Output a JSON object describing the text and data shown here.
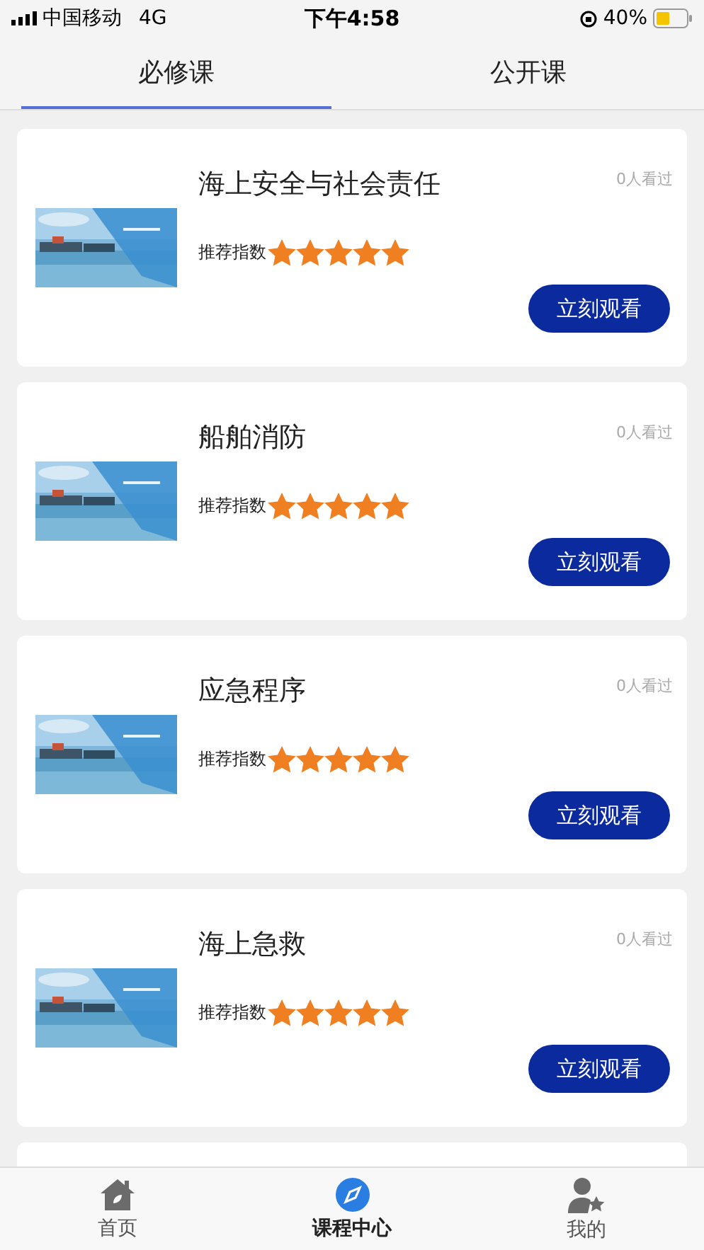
{
  "status_bar": {
    "carrier": "中国移动",
    "network": "4G",
    "time": "下午4:58",
    "battery": "40%"
  },
  "tabs": [
    {
      "label": "必修课",
      "selected": true
    },
    {
      "label": "公开课",
      "selected": false
    }
  ],
  "courses": [
    {
      "title": "海上安全与社会责任",
      "views": "0人看过",
      "rating_label": "推荐指数",
      "stars": 5,
      "button": "立刻观看"
    },
    {
      "title": "船舶消防",
      "views": "0人看过",
      "rating_label": "推荐指数",
      "stars": 5,
      "button": "立刻观看"
    },
    {
      "title": "应急程序",
      "views": "0人看过",
      "rating_label": "推荐指数",
      "stars": 5,
      "button": "立刻观看"
    },
    {
      "title": "海上急救",
      "views": "0人看过",
      "rating_label": "推荐指数",
      "stars": 5,
      "button": "立刻观看"
    }
  ],
  "bottom_nav": [
    {
      "label": "首页",
      "kind": "home",
      "selected": false
    },
    {
      "label": "课程中心",
      "kind": "compass",
      "selected": true
    },
    {
      "label": "我的",
      "kind": "user",
      "selected": false
    }
  ]
}
